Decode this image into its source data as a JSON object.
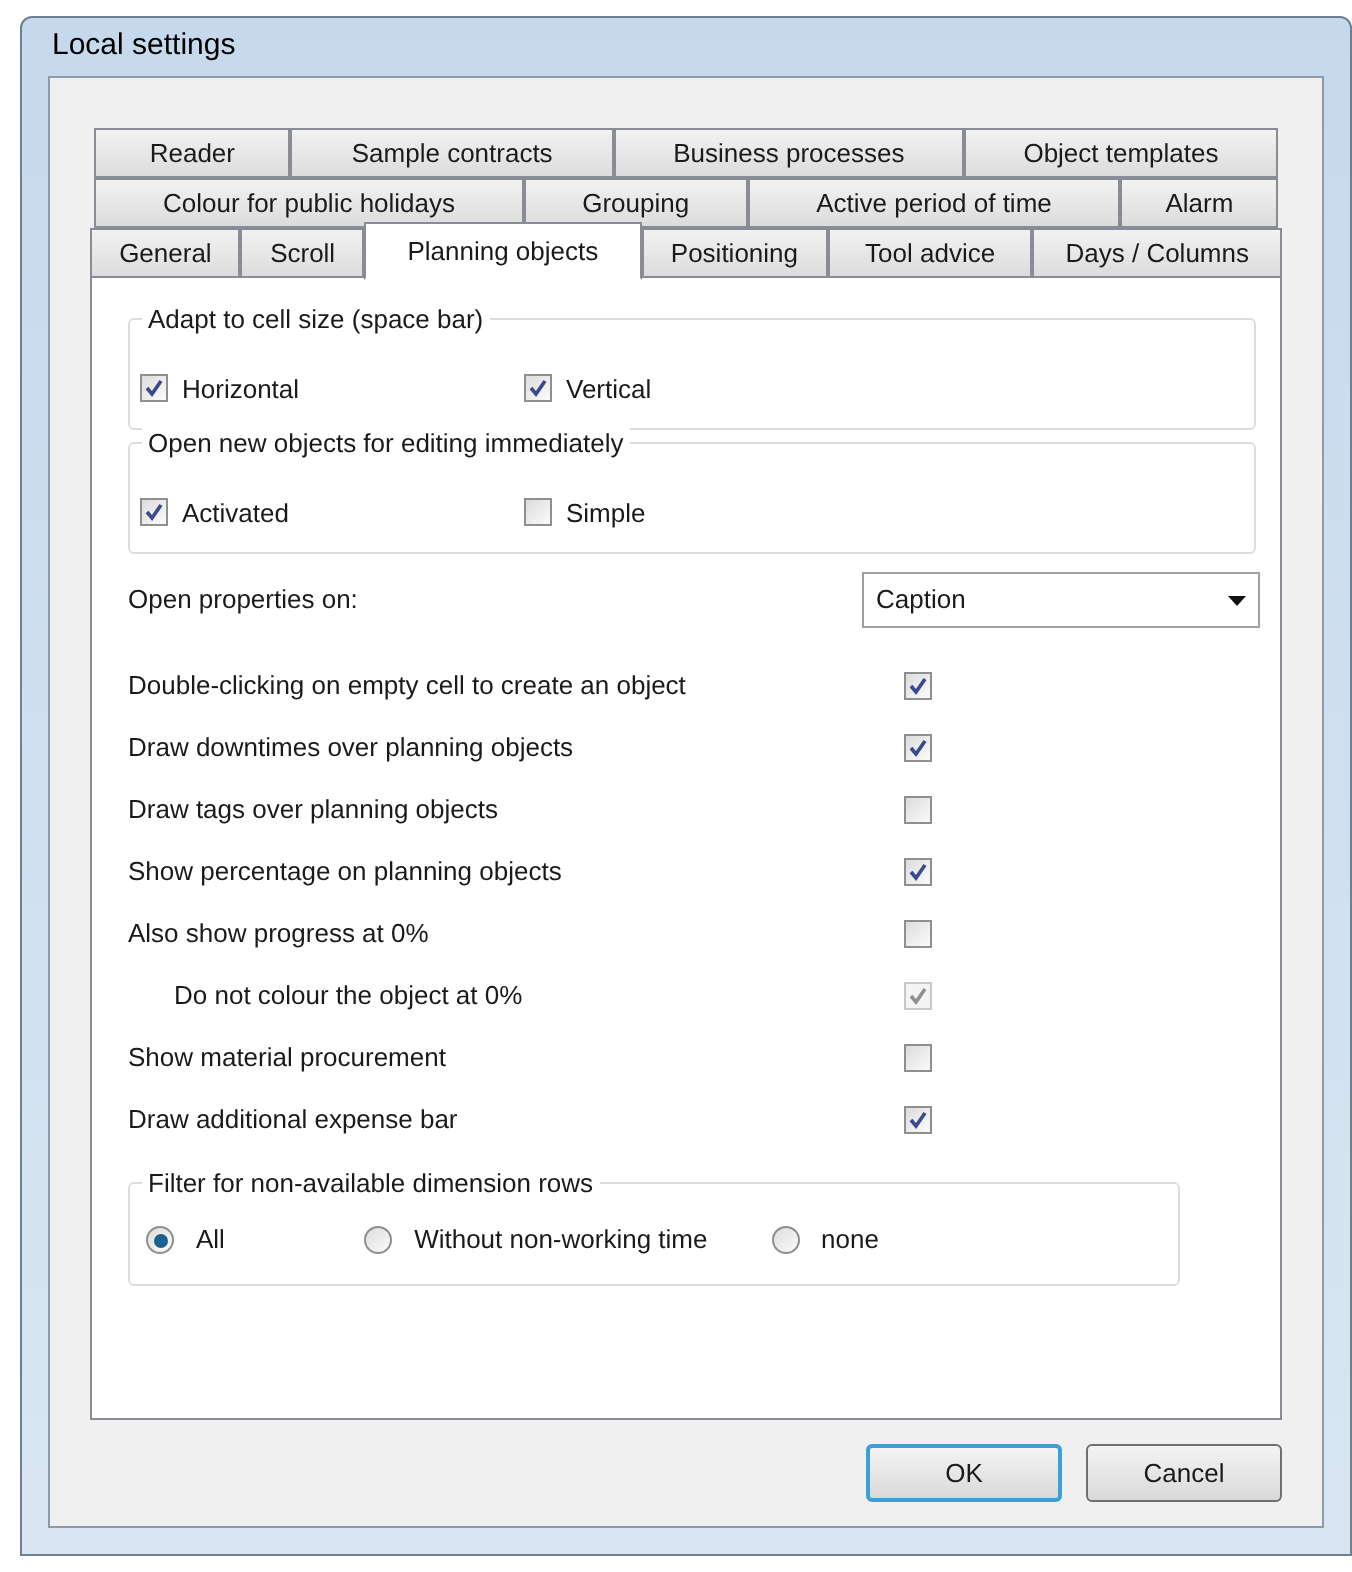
{
  "window": {
    "title": "Local settings"
  },
  "tab_rows": [
    [
      {
        "label": "Reader",
        "selected": false
      },
      {
        "label": "Sample contracts",
        "selected": false
      },
      {
        "label": "Business processes",
        "selected": false
      },
      {
        "label": "Object templates",
        "selected": false
      }
    ],
    [
      {
        "label": "Colour for public holidays",
        "selected": false
      },
      {
        "label": "Grouping",
        "selected": false
      },
      {
        "label": "Active period of time",
        "selected": false
      },
      {
        "label": "Alarm",
        "selected": false
      }
    ],
    [
      {
        "label": "General",
        "selected": false
      },
      {
        "label": "Scroll",
        "selected": false
      },
      {
        "label": "Planning objects",
        "selected": true
      },
      {
        "label": "Positioning",
        "selected": false
      },
      {
        "label": "Tool advice",
        "selected": false
      },
      {
        "label": "Days / Columns",
        "selected": false
      }
    ]
  ],
  "groups": [
    {
      "title": "Adapt to cell size (space bar)",
      "options": [
        {
          "label": "Horizontal",
          "checked": true
        },
        {
          "label": "Vertical",
          "checked": true
        }
      ]
    },
    {
      "title": "Open new objects for editing immediately",
      "options": [
        {
          "label": "Activated",
          "checked": true
        },
        {
          "label": "Simple",
          "checked": false
        }
      ]
    }
  ],
  "open_properties": {
    "label": "Open properties on:",
    "value": "Caption"
  },
  "options": [
    {
      "label": "Double-clicking on empty cell to create an object",
      "checked": true,
      "disabled": false
    },
    {
      "label": "Draw downtimes over planning objects",
      "checked": true,
      "disabled": false
    },
    {
      "label": "Draw tags over planning objects",
      "checked": false,
      "disabled": false
    },
    {
      "label": "Show percentage on planning objects",
      "checked": true,
      "disabled": false
    },
    {
      "label": "Also show progress at 0%",
      "checked": false,
      "disabled": false,
      "children": [
        {
          "label": "Do not colour the object at 0%",
          "checked": true,
          "disabled": true
        }
      ]
    },
    {
      "label": "Show material procurement",
      "checked": false,
      "disabled": false
    },
    {
      "label": "Draw additional expense bar",
      "checked": true,
      "disabled": false
    }
  ],
  "filter": {
    "title": "Filter for non-available dimension rows",
    "options": [
      {
        "label": "All",
        "selected": true
      },
      {
        "label": "Without non-working time",
        "selected": false
      },
      {
        "label": "none",
        "selected": false
      }
    ]
  },
  "buttons": [
    {
      "label": "OK",
      "default": true
    },
    {
      "label": "Cancel",
      "default": false
    }
  ]
}
